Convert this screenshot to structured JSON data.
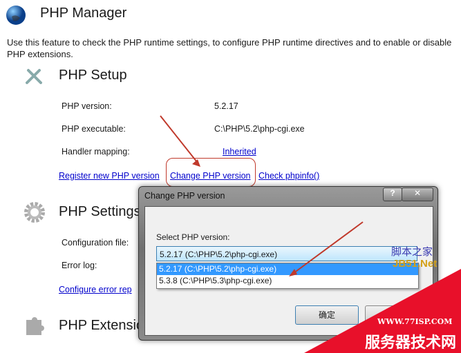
{
  "header": {
    "title": "PHP Manager",
    "description": "Use this feature to check the PHP runtime settings, to configure PHP runtime directives and to enable or disable PHP extensions."
  },
  "setup": {
    "title": "PHP Setup",
    "rows": [
      {
        "label": "PHP version:",
        "value": "5.2.17"
      },
      {
        "label": "PHP executable:",
        "value": "C:\\PHP\\5.2\\php-cgi.exe"
      },
      {
        "label": "Handler mapping:",
        "value": "Inherited"
      }
    ],
    "links": [
      "Register new PHP version",
      "Change PHP version",
      "Check phpinfo()"
    ]
  },
  "settings": {
    "title": "PHP Settings",
    "rows": [
      "Configuration file:",
      "Error log:"
    ],
    "link": "Configure error rep"
  },
  "extensions": {
    "title": "PHP Extensio"
  },
  "dialog": {
    "title": "Change PHP version",
    "help": "?",
    "close": "✕",
    "label": "Select PHP version:",
    "selected": "5.2.17 (C:\\PHP\\5.2\\php-cgi.exe)",
    "options": [
      "5.2.17 (C:\\PHP\\5.2\\php-cgi.exe)",
      "5.3.8 (C:\\PHP\\5.3\\php-cgi.exe)"
    ],
    "ok": "确定"
  },
  "watermarks": {
    "jb51_top": "脚本之家",
    "jb51_bottom": "JB51.Net",
    "site": "WWW.77ISP.COM",
    "site_name": "服务器技术网"
  },
  "colors": {
    "link": "#0000cc",
    "annotation": "#c0392b",
    "watermark": "#e8102a",
    "selection": "#3399ff"
  }
}
